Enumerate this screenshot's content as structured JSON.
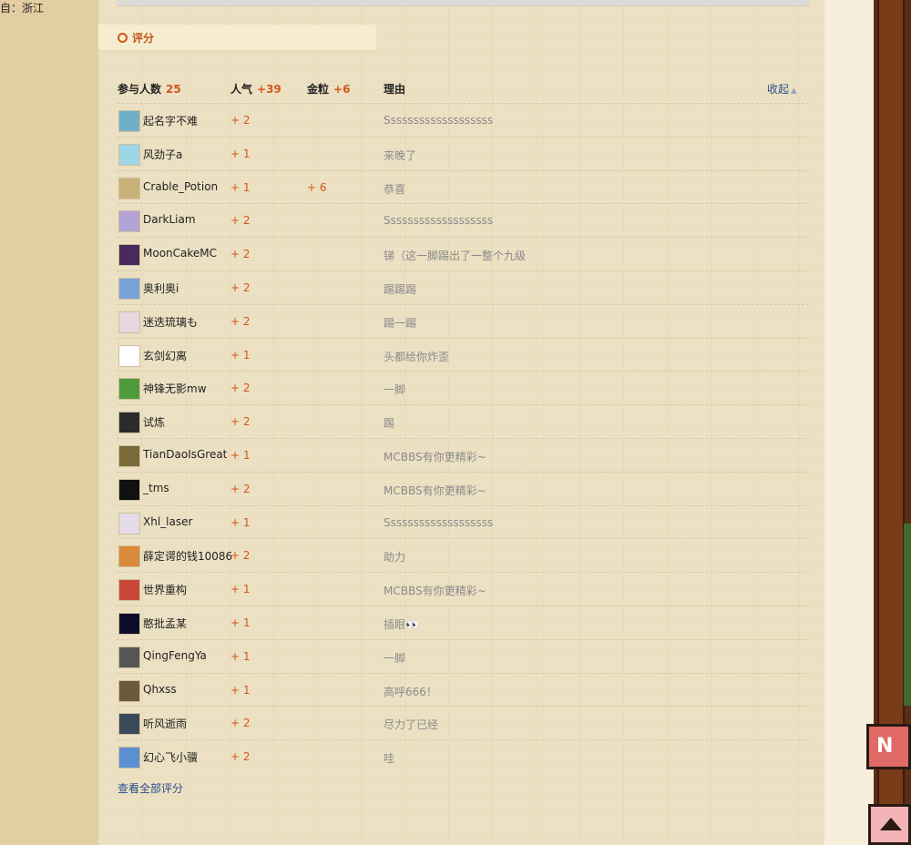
{
  "sidebar": {
    "location": "自：浙江"
  },
  "rating": {
    "title": "评分",
    "participants_label": "参与人数",
    "participants_count": "25",
    "popularity_label": "人气",
    "popularity_total": "+39",
    "gold_label": "金粒",
    "gold_total": "+6",
    "reason_label": "理由",
    "collapse_label": "收起",
    "view_all_label": "查看全部评分",
    "rows": [
      {
        "user": "起名字不难",
        "pop": "+ 2",
        "gold": "",
        "reason": "Sssssssssssssssssss",
        "avatar": "#6fb0c9"
      },
      {
        "user": "风劲子a",
        "pop": "+ 1",
        "gold": "",
        "reason": "来晚了",
        "avatar": "#9fd6e6"
      },
      {
        "user": "Crable_Potion",
        "pop": "+ 1",
        "gold": "+ 6",
        "reason": "恭喜",
        "avatar": "#c9b27a"
      },
      {
        "user": "DarkLiam",
        "pop": "+ 2",
        "gold": "",
        "reason": "Sssssssssssssssssss",
        "avatar": "#b3a3d6"
      },
      {
        "user": "MoonCakeMC",
        "pop": "+ 2",
        "gold": "",
        "reason": "锑（这一脚踢出了一整个九级",
        "avatar": "#4a2a5c"
      },
      {
        "user": "奥利奥i",
        "pop": "+ 2",
        "gold": "",
        "reason": "踢踢踢",
        "avatar": "#7aa2d8"
      },
      {
        "user": "迷迭琉璃も",
        "pop": "+ 2",
        "gold": "",
        "reason": "踢一踢",
        "avatar": "#e8d7e0"
      },
      {
        "user": "玄剑幻离",
        "pop": "+ 1",
        "gold": "",
        "reason": "头都给你炸歪",
        "avatar": "#ffffff"
      },
      {
        "user": "神锋无影mw",
        "pop": "+ 2",
        "gold": "",
        "reason": "一脚",
        "avatar": "#4f9a3c"
      },
      {
        "user": "试炼",
        "pop": "+ 2",
        "gold": "",
        "reason": "踢",
        "avatar": "#2b2b2b"
      },
      {
        "user": "TianDaoIsGreat",
        "pop": "+ 1",
        "gold": "",
        "reason": "MCBBS有你更精彩~",
        "avatar": "#7a6a3a"
      },
      {
        "user": "_tms",
        "pop": "+ 2",
        "gold": "",
        "reason": "MCBBS有你更精彩~",
        "avatar": "#111111"
      },
      {
        "user": "Xhl_laser",
        "pop": "+ 1",
        "gold": "",
        "reason": "Sssssssssssssssssss",
        "avatar": "#e6dbe8"
      },
      {
        "user": "薛定谔的钱10086",
        "pop": "+ 2",
        "gold": "",
        "reason": "助力",
        "avatar": "#d98a3a"
      },
      {
        "user": "世界重构",
        "pop": "+ 1",
        "gold": "",
        "reason": "MCBBS有你更精彩~",
        "avatar": "#c9473a"
      },
      {
        "user": "憨批孟某",
        "pop": "+ 1",
        "gold": "",
        "reason": "插眼👀",
        "avatar": "#0c0c2a"
      },
      {
        "user": "QingFengYa",
        "pop": "+ 1",
        "gold": "",
        "reason": "一脚",
        "avatar": "#555555"
      },
      {
        "user": "Qhxss",
        "pop": "+ 1",
        "gold": "",
        "reason": "高呼666！",
        "avatar": "#6a5a3a"
      },
      {
        "user": "听风逝雨",
        "pop": "+ 2",
        "gold": "",
        "reason": "尽力了已经",
        "avatar": "#3a4a5a"
      },
      {
        "user": "幻心飞小骥",
        "pop": "+ 2",
        "gold": "",
        "reason": "哇",
        "avatar": "#5a8fd0"
      }
    ]
  }
}
